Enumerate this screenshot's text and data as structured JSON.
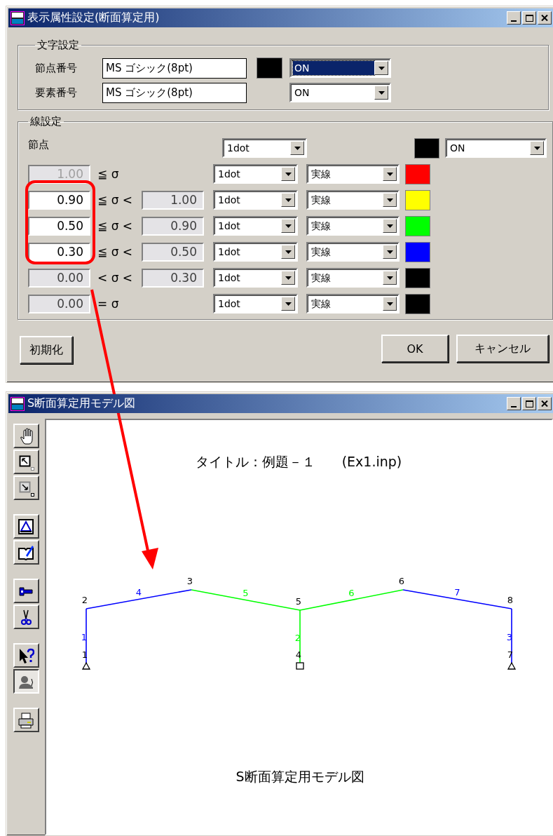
{
  "dialog": {
    "title": "表示属性設定(断面算定用)",
    "text_settings": {
      "legend": "文字設定",
      "rows": [
        {
          "label": "節点番号",
          "font": "MS ゴシック(8pt)",
          "color": "#000000",
          "option": "ON",
          "focused": true
        },
        {
          "label": "要素番号",
          "font": "MS ゴシック(8pt)",
          "option": "ON",
          "focused": false
        }
      ]
    },
    "line_settings": {
      "legend": "線設定",
      "node_row": {
        "label": "節点",
        "width": "1dot",
        "color": "#000000",
        "option": "ON"
      },
      "stress_rows": [
        {
          "lower": "1.00",
          "lower_disabled": true,
          "lower_editable": false,
          "relation": "≦ σ",
          "width": "1dot",
          "style": "実線",
          "color": "#ff0000"
        },
        {
          "lower": "0.90",
          "lower_disabled": false,
          "lower_editable": true,
          "relation": "≦ σ <",
          "upper": "1.00",
          "width": "1dot",
          "style": "実線",
          "color": "#ffff00"
        },
        {
          "lower": "0.50",
          "lower_disabled": false,
          "lower_editable": true,
          "relation": "≦ σ <",
          "upper": "0.90",
          "width": "1dot",
          "style": "実線",
          "color": "#00ff00"
        },
        {
          "lower": "0.30",
          "lower_disabled": false,
          "lower_editable": true,
          "relation": "≦ σ <",
          "upper": "0.50",
          "width": "1dot",
          "style": "実線",
          "color": "#0000ff"
        },
        {
          "lower": "0.00",
          "lower_disabled": false,
          "lower_editable": false,
          "relation": "< σ <",
          "upper": "0.30",
          "width": "1dot",
          "style": "実線",
          "color": "#000000"
        },
        {
          "lower": "0.00",
          "lower_disabled": false,
          "lower_editable": false,
          "relation": "= σ",
          "width": "1dot",
          "style": "実線",
          "color": "#000000"
        }
      ]
    },
    "buttons": {
      "reset": "初期化",
      "ok": "OK",
      "cancel": "キャンセル"
    }
  },
  "model_window": {
    "title": "S断面算定用モデル図",
    "toolbar_groups": [
      [
        {
          "kind": "hand",
          "selected": false
        },
        {
          "kind": "zoom-box",
          "selected": false
        },
        {
          "kind": "zoom-box-out",
          "selected": false
        }
      ],
      [
        {
          "kind": "triangle",
          "selected": false
        },
        {
          "kind": "book-pen",
          "selected": false
        }
      ],
      [
        {
          "kind": "wrench",
          "selected": false
        },
        {
          "kind": "scissors",
          "selected": false
        }
      ],
      [
        {
          "kind": "help-pointer",
          "selected": false
        },
        {
          "kind": "profile",
          "selected": true
        }
      ],
      [
        {
          "kind": "printer",
          "selected": false
        }
      ]
    ],
    "canvas": {
      "title": "タイトル：例題－１　　(Ex1.inp)",
      "caption": "S断面算定用モデル図",
      "nodes": [
        {
          "label": "1",
          "kind": "pin"
        },
        {
          "label": "2",
          "kind": "free"
        },
        {
          "label": "3",
          "kind": "free"
        },
        {
          "label": "4",
          "kind": "fixed"
        },
        {
          "label": "5",
          "kind": "free"
        },
        {
          "label": "6",
          "kind": "free"
        },
        {
          "label": "7",
          "kind": "pin"
        },
        {
          "label": "8",
          "kind": "free"
        }
      ],
      "members": [
        {
          "label": "1",
          "color": "#0000ff"
        },
        {
          "label": "2",
          "color": "#00ff00"
        },
        {
          "label": "3",
          "color": "#0000ff"
        },
        {
          "label": "4",
          "color": "#0000ff"
        },
        {
          "label": "5",
          "color": "#00ff00"
        },
        {
          "label": "6",
          "color": "#00ff00"
        },
        {
          "label": "7",
          "color": "#0000ff"
        }
      ]
    }
  }
}
